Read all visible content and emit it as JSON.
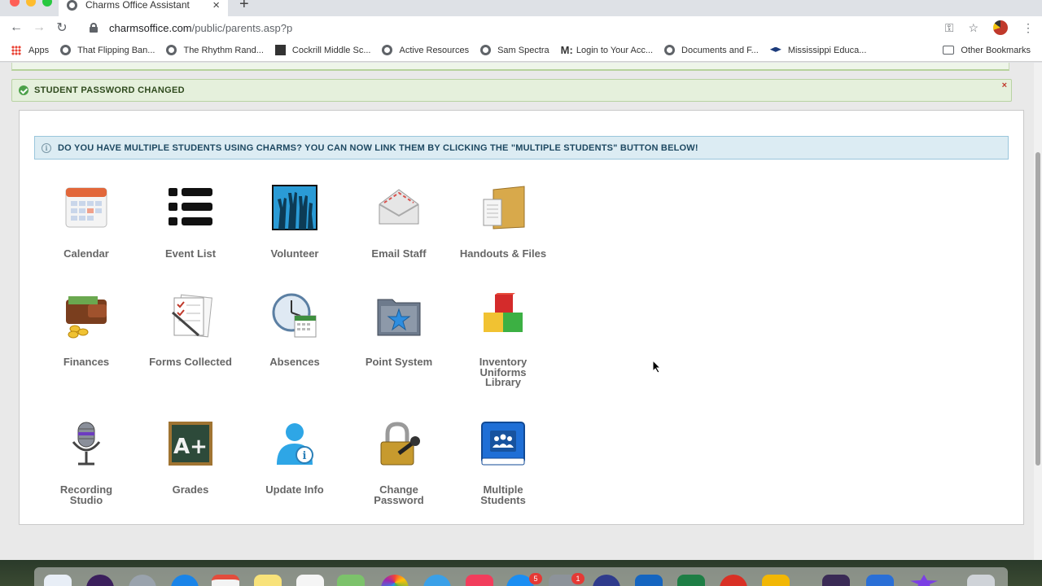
{
  "browser": {
    "tab_title": "Charms Office Assistant",
    "url_host": "charmsoffice.com",
    "url_path": "/public/parents.asp?p",
    "bookmarks": [
      {
        "label": "Apps",
        "icon": "apps-grid-icon"
      },
      {
        "label": "That Flipping Ban...",
        "icon": "globe-icon"
      },
      {
        "label": "The Rhythm Rand...",
        "icon": "globe-icon"
      },
      {
        "label": "Cockrill Middle Sc...",
        "icon": "school-logo-icon"
      },
      {
        "label": "Active Resources",
        "icon": "globe-icon"
      },
      {
        "label": "Sam Spectra",
        "icon": "globe-icon"
      },
      {
        "label": "Login to Your Acc...",
        "icon": "m-logo-icon",
        "prefix": "M:"
      },
      {
        "label": "Documents and F...",
        "icon": "globe-icon"
      },
      {
        "label": "Mississippi Educa...",
        "icon": "grad-cap-icon"
      }
    ],
    "other_bookmarks": "Other Bookmarks"
  },
  "alerts": {
    "success": "STUDENT PASSWORD CHANGED",
    "close": "×",
    "info": "DO YOU HAVE MULTIPLE STUDENTS USING CHARMS? YOU CAN NOW LINK THEM BY CLICKING THE \"MULTIPLE STUDENTS\" BUTTON BELOW!"
  },
  "tiles": [
    {
      "label": "Calendar",
      "icon": "calendar-icon"
    },
    {
      "label": "Event List",
      "icon": "list-icon"
    },
    {
      "label": "Volunteer",
      "icon": "raised-hands-icon"
    },
    {
      "label": "Email Staff",
      "icon": "envelope-icon"
    },
    {
      "label": "Handouts & Files",
      "icon": "folder-files-icon"
    },
    {
      "label": "Finances",
      "icon": "wallet-icon"
    },
    {
      "label": "Forms Collected",
      "icon": "forms-icon"
    },
    {
      "label": "Absences",
      "icon": "clock-calendar-icon"
    },
    {
      "label": "Point System",
      "icon": "star-folder-icon"
    },
    {
      "label": "Inventory Uniforms Library",
      "icon": "blocks-icon"
    },
    {
      "label": "Recording Studio",
      "icon": "microphone-icon"
    },
    {
      "label": "Grades",
      "icon": "chalkboard-grade-icon"
    },
    {
      "label": "Update Info",
      "icon": "user-info-icon"
    },
    {
      "label": "Change Password",
      "icon": "padlock-key-icon"
    },
    {
      "label": "Multiple Students",
      "icon": "group-book-icon"
    }
  ],
  "dock": {
    "badges": [
      "5",
      "1"
    ]
  }
}
